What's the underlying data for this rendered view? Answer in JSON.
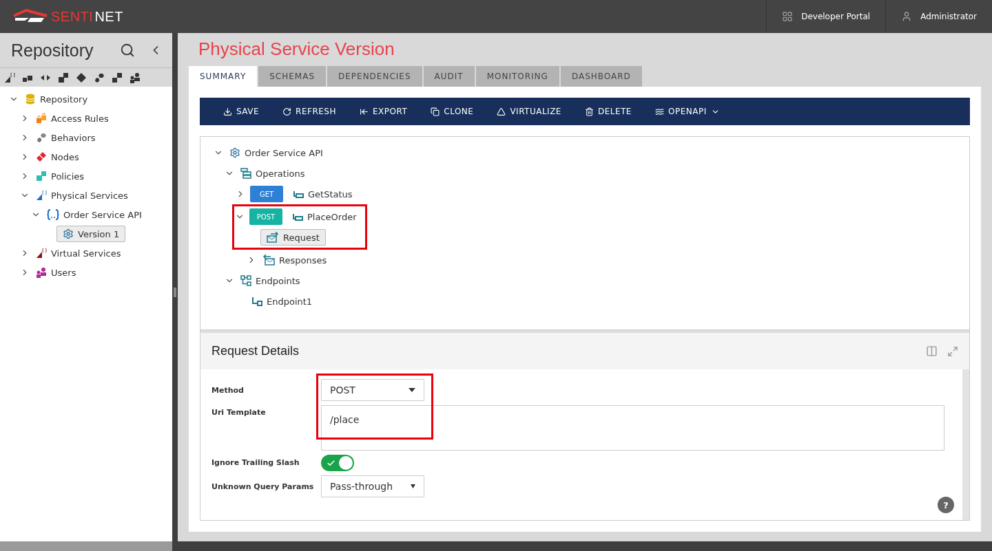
{
  "header": {
    "logo": [
      "SENTI",
      "NET"
    ],
    "links": [
      {
        "label": "Developer Portal",
        "kind": "portal"
      },
      {
        "label": "Administrator",
        "kind": "account"
      }
    ]
  },
  "sidebar": {
    "title": "Repository",
    "tree": [
      {
        "label": "Repository",
        "kind": "database",
        "expanded": true,
        "selected": false,
        "children": [
          {
            "label": "Access Rules",
            "kind": "locks",
            "expanded": false,
            "selected": false
          },
          {
            "label": "Behaviors",
            "kind": "hexes",
            "expanded": false,
            "selected": false
          },
          {
            "label": "Nodes",
            "kind": "diamonds",
            "expanded": false,
            "selected": false
          },
          {
            "label": "Policies",
            "kind": "squares",
            "expanded": false,
            "selected": false
          },
          {
            "label": "Physical Services",
            "kind": "service",
            "expanded": true,
            "selected": false,
            "children": [
              {
                "label": "Order Service API",
                "kind": "braces",
                "expanded": true,
                "selected": false,
                "children": [
                  {
                    "label": "Version 1",
                    "kind": "gear",
                    "selected": true
                  }
                ]
              }
            ]
          },
          {
            "label": "Virtual Services",
            "kind": "vservice",
            "expanded": false,
            "selected": false
          },
          {
            "label": "Users",
            "kind": "users",
            "expanded": false,
            "selected": false
          }
        ]
      }
    ]
  },
  "page": {
    "title": "Physical Service Version",
    "tabs": [
      {
        "label": "SUMMARY",
        "selected": true
      },
      {
        "label": "SCHEMAS",
        "selected": false
      },
      {
        "label": "DEPENDENCIES",
        "selected": false
      },
      {
        "label": "AUDIT",
        "selected": false
      },
      {
        "label": "MONITORING",
        "selected": false
      },
      {
        "label": "DASHBOARD",
        "selected": false
      }
    ],
    "toolbar": [
      {
        "label": "SAVE",
        "kind": "save"
      },
      {
        "label": "REFRESH",
        "kind": "refresh"
      },
      {
        "label": "EXPORT",
        "kind": "export"
      },
      {
        "label": "CLONE",
        "kind": "clone"
      },
      {
        "label": "VIRTUALIZE",
        "kind": "virtualize"
      },
      {
        "label": "DELETE",
        "kind": "delete"
      },
      {
        "label": "OPENAPI",
        "kind": "openapi",
        "dropdown": true
      }
    ],
    "tree": [
      {
        "label": "Order Service API",
        "kind": "gear",
        "expanded": true,
        "selected": false,
        "children": [
          {
            "label": "Operations",
            "kind": "ops",
            "expanded": true,
            "selected": false,
            "children": [
              {
                "label": "GetStatus",
                "kind": "op",
                "method": "GET",
                "expanded": false,
                "selected": false,
                "highlighted": false
              },
              {
                "label": "PlaceOrder",
                "kind": "op",
                "method": "POST",
                "expanded": true,
                "selected": false,
                "highlighted": true,
                "children": [
                  {
                    "label": "Request",
                    "kind": "request",
                    "selected": true
                  },
                  {
                    "label": "Responses",
                    "kind": "responses",
                    "expanded": false,
                    "selected": false
                  }
                ]
              }
            ]
          },
          {
            "label": "Endpoints",
            "kind": "endpoints",
            "expanded": true,
            "selected": false,
            "children": [
              {
                "label": "Endpoint1",
                "kind": "endpoint",
                "selected": false
              }
            ]
          }
        ]
      }
    ],
    "details": {
      "title": "Request Details",
      "highlighted": true,
      "fields": [
        {
          "label": "Method",
          "kind": "dropdown",
          "value": "POST"
        },
        {
          "label": "Uri Template",
          "kind": "textarea",
          "value": "/place"
        },
        {
          "label": "Ignore Trailing Slash",
          "kind": "toggle",
          "on": true
        },
        {
          "label": "Unknown Query Params",
          "kind": "select",
          "value": "Pass-through"
        }
      ],
      "help": "?"
    }
  }
}
